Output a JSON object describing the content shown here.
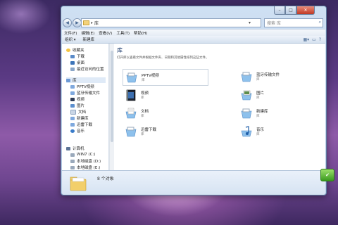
{
  "window": {
    "controls": {
      "minimize": "–",
      "maximize": "□",
      "close": "✕"
    }
  },
  "address": {
    "back": "◀",
    "forward": "▶",
    "path_separator": "▸",
    "path": "库",
    "dropdown": "▾",
    "refresh": "⟳",
    "search_placeholder": "搜索 库"
  },
  "menu": {
    "items": [
      "文件(F)",
      "编辑(E)",
      "查看(V)",
      "工具(T)",
      "帮助(H)"
    ]
  },
  "toolbar": {
    "organize": "组织 ▾",
    "new_library": "新建库"
  },
  "sidebar": {
    "favorites": {
      "label": "收藏夹",
      "items": [
        "下载",
        "桌面",
        "最近访问的位置"
      ]
    },
    "libraries": {
      "label": "库",
      "items": [
        "PPTV视频",
        "蓝牙传输文件",
        "视频",
        "图片",
        "文档",
        "新建库",
        "迅雷下载",
        "音乐"
      ]
    },
    "computer": {
      "label": "计算机",
      "items": [
        "WIN7 (C:)",
        "本地磁盘 (D:)",
        "本地磁盘 (E:)"
      ]
    }
  },
  "main": {
    "title": "库",
    "description": "打开库以查看文件并根据文件夹、日期和其他属性排列这些文件。",
    "tiles": [
      {
        "name": "PPTV视频",
        "sub": "库"
      },
      {
        "name": "蓝牙传输文件",
        "sub": "库"
      },
      {
        "name": "视频",
        "sub": "库"
      },
      {
        "name": "图片",
        "sub": "库"
      },
      {
        "name": "文档",
        "sub": "库"
      },
      {
        "name": "新建库",
        "sub": "库"
      },
      {
        "name": "迅雷下载",
        "sub": "库"
      },
      {
        "name": "音乐",
        "sub": "库"
      }
    ]
  },
  "details": {
    "count": "8 个对象"
  },
  "gadget": {
    "symbol": "✔"
  }
}
